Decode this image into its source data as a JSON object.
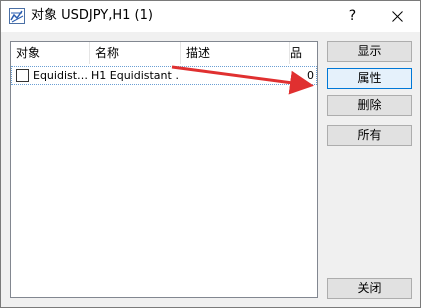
{
  "window": {
    "title": "对象 USDJPY,H1 (1)",
    "help_label": "?",
    "close_icon": "close-icon"
  },
  "list": {
    "columns": [
      "对象",
      "名称",
      "描述",
      "品"
    ],
    "rows": [
      {
        "checked": false,
        "object": "Equidist…",
        "name": "H1 Equidistant …",
        "description": "",
        "count": "0"
      }
    ]
  },
  "buttons": {
    "show": "显示",
    "properties": "属性",
    "delete": "删除",
    "all": "所有",
    "close": "关闭"
  },
  "colors": {
    "annotation_arrow": "#e03030",
    "focus_border": "#0078d7",
    "row_focus_border": "#6a9fd4"
  }
}
